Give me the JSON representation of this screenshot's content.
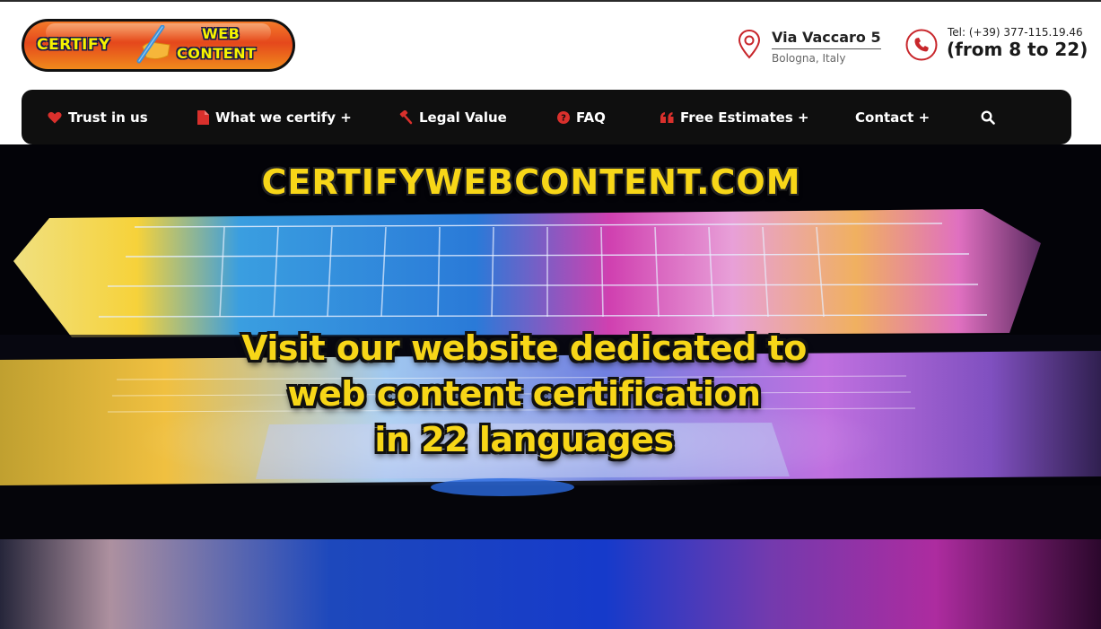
{
  "logo": {
    "line1": "CERTIFY",
    "line2": "WEB",
    "line3": "CONTENT",
    "colors": {
      "body": "#e5481c",
      "text": "#f6f200",
      "pen": "#3a8fd8"
    }
  },
  "contact": {
    "address": {
      "icon": "map-pin-icon",
      "street": "Via Vaccaro 5",
      "city": "Bologna, Italy"
    },
    "phone": {
      "icon": "phone-icon",
      "tel": "Tel: (+39) 377-115.19.46",
      "hours": "(from 8 to 22)"
    },
    "accent": "#c8262b"
  },
  "nav": {
    "items": [
      {
        "label": "Trust in us",
        "icon": "heart-icon"
      },
      {
        "label": "What we certify +",
        "icon": "file-icon"
      },
      {
        "label": "Legal Value",
        "icon": "gavel-icon"
      },
      {
        "label": "FAQ",
        "icon": "question-circle-icon"
      },
      {
        "label": "Free Estimates +",
        "icon": "quote-icon"
      },
      {
        "label": "Contact +",
        "icon": ""
      }
    ],
    "search_icon": "search-icon",
    "icon_color": "#d9302c"
  },
  "hero": {
    "title": "CERTIFYWEBCONTENT.COM",
    "message_lines": [
      "Visit our website dedicated to",
      "web content certification",
      "in 22 languages"
    ],
    "text_color": "#f7d618"
  }
}
